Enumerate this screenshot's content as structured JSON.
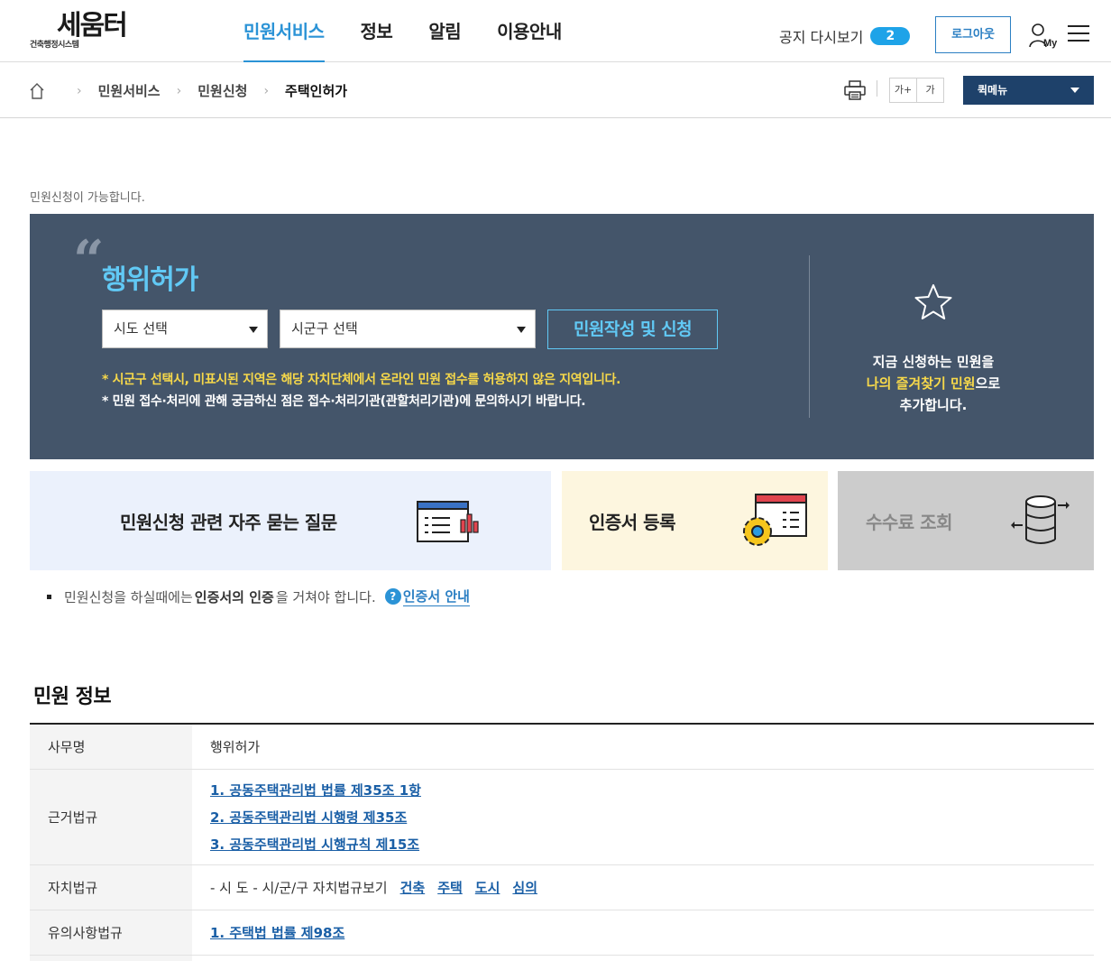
{
  "header": {
    "logo_text": "세움터",
    "logo_sub": "건축행정시스템",
    "nav": [
      "민원서비스",
      "정보",
      "알림",
      "이용안내"
    ],
    "notice_label": "공지 다시보기",
    "notice_count": "2",
    "logout": "로그아웃",
    "my_label": "My"
  },
  "breadcrumb": {
    "items": [
      "민원서비스",
      "민원신청",
      "주택인허가"
    ],
    "font_larger": "가+",
    "font_normal": "가",
    "quick_menu": "퀵메뉴"
  },
  "intro": "민원신청이 가능합니다.",
  "panel": {
    "title": "행위허가",
    "sido_placeholder": "시도 선택",
    "sigungu_placeholder": "시군구 선택",
    "apply": "민원작성 및 신청",
    "note_warning": "* 시군구 선택시, 미표시된 지역은 해당 자치단체에서 온라인 민원 접수를 허용하지 않은 지역입니다.",
    "note_info": "* 민원 접수·처리에 관해 궁금하신 점은 접수·처리기관(관할처리기관)에 문의하시기 바랍니다.",
    "fav_line1": "지금 신청하는 민원을",
    "fav_highlight": "나의 즐겨찾기 민원",
    "fav_suffix": "으로",
    "fav_line3": "추가합니다."
  },
  "cards": {
    "faq": "민원신청 관련 자주 묻는 질문",
    "cert": "인증서 등록",
    "fee": "수수료 조회"
  },
  "cert_note": {
    "prefix": "민원신청을 하실때에는",
    "bold": "인증서의 인증",
    "suffix": "을 거쳐야 합니다.",
    "link": "인증서 안내"
  },
  "info": {
    "title": "민원 정보",
    "rows": {
      "name_label": "사무명",
      "name_value": "행위허가",
      "law_label": "근거법규",
      "laws": [
        "1. 공동주택관리법 법률 제35조 1항",
        "2. 공동주택관리법 시행령 제35조",
        "3. 공동주택관리법 시행규칙 제15조"
      ],
      "local_label": "자치법규",
      "local_text": "- 시 도 - 시/군/구 자치법규보기",
      "local_links": [
        "건축",
        "주택",
        "도시",
        "심의"
      ],
      "caution_label": "유의사항법규",
      "caution_law": "1. 주택법 법률 제98조"
    }
  }
}
